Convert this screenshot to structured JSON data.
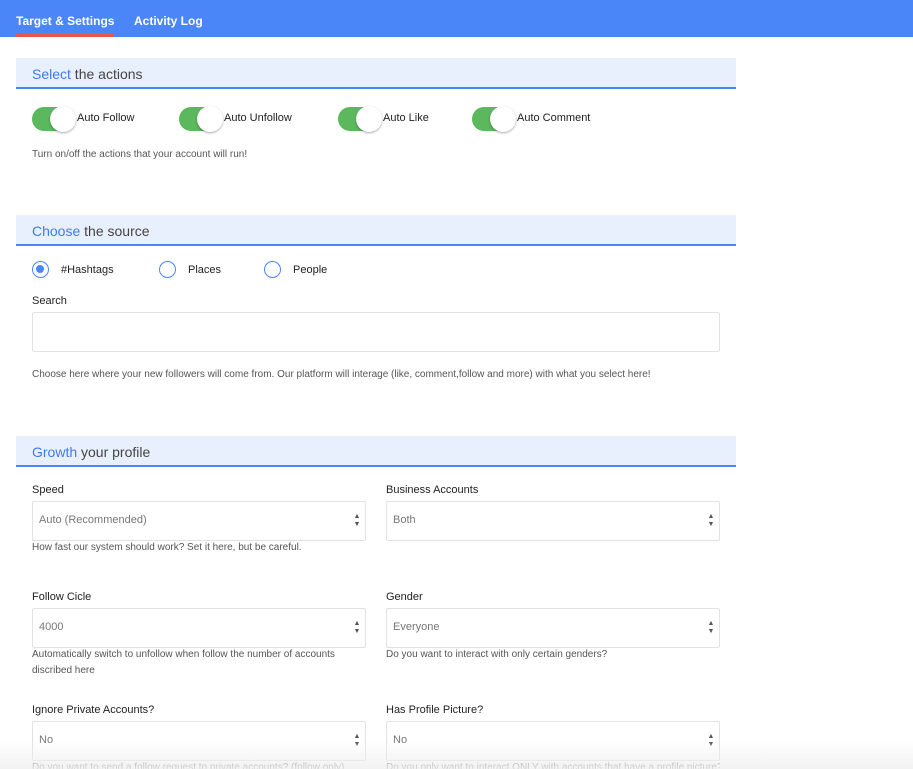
{
  "nav": {
    "tabs": [
      {
        "label": "Target & Settings",
        "active": true
      },
      {
        "label": "Activity Log",
        "active": false
      }
    ]
  },
  "colors": {
    "nav_bg": "#4a86f7",
    "active_tab_underline": "#e8574c",
    "section_bg": "#e9f0fd",
    "accent": "#3d7bf0",
    "toggle_on": "#5cb85c"
  },
  "actions": {
    "title_accent": "Select",
    "title_rest": " the actions",
    "toggles": [
      {
        "label": "Auto Follow",
        "on": true
      },
      {
        "label": "Auto Unfollow",
        "on": true
      },
      {
        "label": "Auto Like",
        "on": true
      },
      {
        "label": "Auto Comment",
        "on": true
      }
    ],
    "help": "Turn on/off the actions that your account will run!"
  },
  "source": {
    "title_accent": "Choose",
    "title_rest": " the source",
    "options": [
      {
        "label": "#Hashtags",
        "checked": true
      },
      {
        "label": "Places",
        "checked": false
      },
      {
        "label": "People",
        "checked": false
      }
    ],
    "search_label": "Search",
    "search_value": "",
    "help": "Choose here where your new followers will come from. Our platform will interage (like, comment,follow and more) with what you select here!"
  },
  "growth": {
    "title_accent": "Growth",
    "title_rest": " your profile",
    "fields": {
      "speed": {
        "label": "Speed",
        "value": "Auto (Recommended)",
        "help": "How fast our system should work? Set it here, but be careful."
      },
      "business": {
        "label": "Business Accounts",
        "value": "Both",
        "help": ""
      },
      "follow_cicle": {
        "label": "Follow Cicle",
        "value": "4000",
        "help": "Automatically switch to unfollow when follow the number of accounts discribed here"
      },
      "gender": {
        "label": "Gender",
        "value": "Everyone",
        "help": "Do you want to interact with only certain genders?"
      },
      "ignore_private": {
        "label": "Ignore Private Accounts?",
        "value": "No",
        "help": "Do you want to send a follow request to private accounts? (follow only)"
      },
      "profile_picture": {
        "label": "Has Profile Picture?",
        "value": "No",
        "help": "Do you only want to interact ONLY with accounts that have a profile picture?"
      }
    }
  }
}
